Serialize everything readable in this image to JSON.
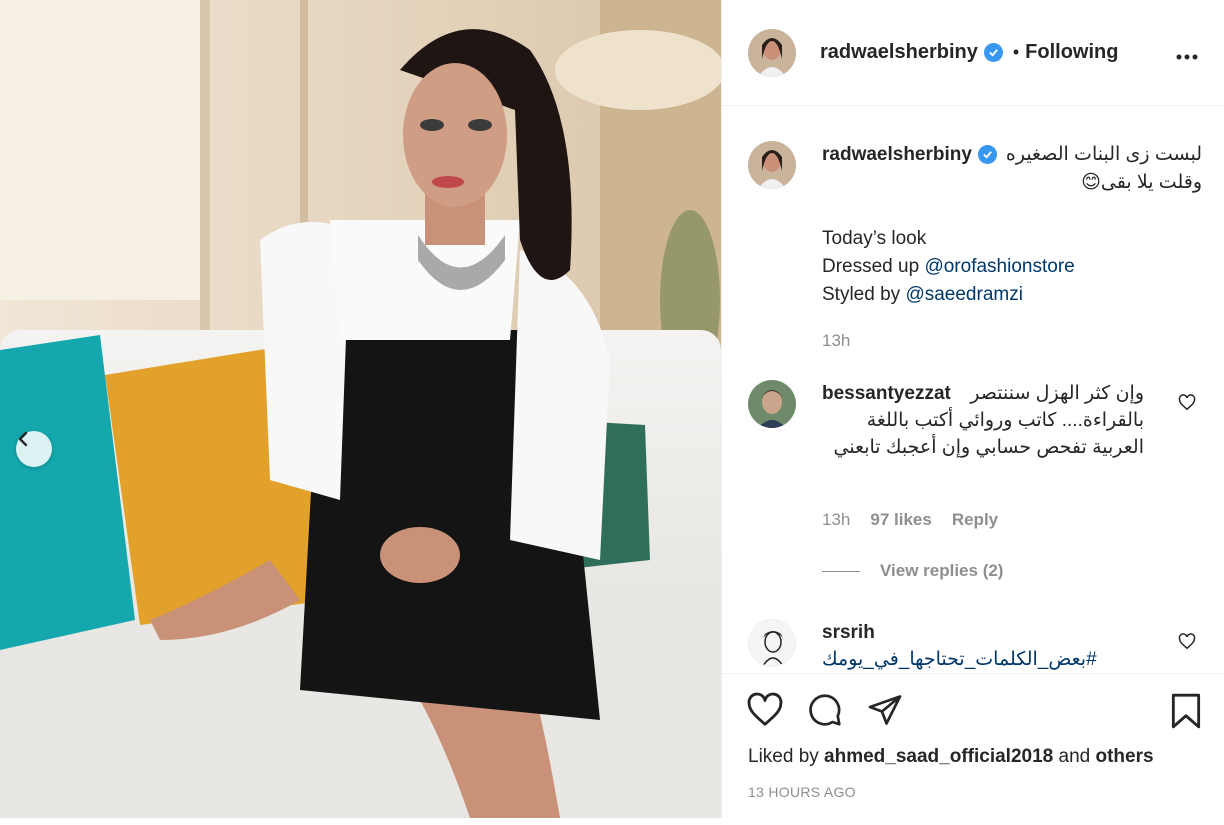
{
  "post": {
    "username": "radwaelsherbiny",
    "follow_status": "Following",
    "separator": "•",
    "more_label": "•••"
  },
  "caption": {
    "username": "radwaelsherbiny",
    "arabic_line": "لبست زى البنات الصغيره وقلت يلا بقى😊",
    "line1": "Today’s look",
    "line2_prefix": "Dressed up ",
    "line2_mention": "@orofashionstore",
    "line3_prefix": "Styled by ",
    "line3_mention": "@saeedramzi",
    "time": "13h"
  },
  "comments": [
    {
      "username": "bessantyezzat",
      "text": "وإن كثر الهزل سننتصر بالقراءة.... كاتب وروائي أكتب باللغة العربية تفحص حسابي وإن أعجبك تابعني",
      "time": "13h",
      "likes": "97 likes",
      "reply_label": "Reply",
      "view_replies": "View replies (2)"
    },
    {
      "username": "srsrih",
      "text": "#بعض_الكلمات_تحتاجها_في_يومك"
    }
  ],
  "footer": {
    "liked_prefix": "Liked by ",
    "liked_user": "ahmed_saad_official2018",
    "liked_and": " and ",
    "liked_others": "others",
    "timestamp": "13 HOURS AGO"
  },
  "colors": {
    "verified": "#3897f0",
    "mention": "#00376b",
    "muted": "#8e8e8e",
    "text": "#262626"
  },
  "icons": {
    "prev": "chevron-left-icon",
    "like": "heart-icon",
    "comment": "comment-icon",
    "share": "send-icon",
    "save": "bookmark-icon"
  }
}
